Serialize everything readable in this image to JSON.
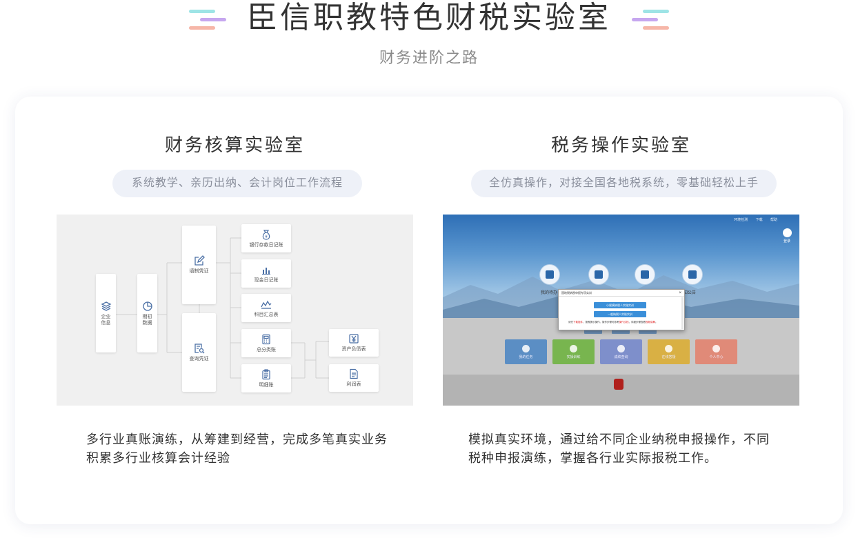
{
  "header": {
    "title": "臣信职教特色财税实验室",
    "subtitle": "财务进阶之路"
  },
  "colors": {
    "deco_teal": "#9ee4e6",
    "deco_purple": "#c6a7ef",
    "deco_peach": "#f6b6a8",
    "pill_bg": "#eef1f8",
    "text_main": "#333333",
    "text_muted": "#8a8f9c"
  },
  "labs": [
    {
      "title": "财务核算实验室",
      "tagline": "系统教学、亲历出纳、会计岗位工作流程",
      "description": "多行业真账演练，从筹建到经营，完成多笔真实业务积累多行业核算会计经验",
      "flow": {
        "nodes": {
          "company_info": "企业信息",
          "opening_data": "期初数据",
          "fill_voucher": "填制凭证",
          "query_voucher": "查询凭证",
          "bank_journal": "银行存款日记账",
          "cash_journal": "现金日记账",
          "account_summary": "科目汇总表",
          "general_ledger": "总分类账",
          "detail_ledger": "明细账",
          "balance_sheet": "资产负债表",
          "income_statement": "利润表"
        },
        "icons": {
          "company_info": "layers-icon",
          "opening_data": "pie-chart-icon",
          "fill_voucher": "edit-icon",
          "query_voucher": "document-search-icon",
          "bank_journal": "money-bag-icon",
          "cash_journal": "chart-icon",
          "account_summary": "line-chart-icon",
          "general_ledger": "calculator-icon",
          "detail_ledger": "clipboard-icon",
          "balance_sheet": "yen-icon",
          "income_statement": "document-icon"
        }
      }
    },
    {
      "title": "税务操作实验室",
      "tagline": "全仿真操作，对接全国各地税系统，零基础轻松上手",
      "description": "模拟真实环境，通过给不同企业纳税申报操作，不同税种申报演练，掌握各行业实际报税工作。",
      "screen": {
        "top_links": [
          "环境检测",
          "下载",
          "帮助"
        ],
        "login_label": "登录",
        "circle_labels": [
          "我的待办",
          "通知公告"
        ],
        "modal": {
          "title": "国地税纳税申报专项实训",
          "close": "×",
          "buttons": [
            "小规模纳税人实账实训",
            "一般纳税人实账实训"
          ],
          "note_prefix": "请先",
          "note_red_1": "下载插件",
          "note_mid": "，按照提示操作。操作步骤可参考",
          "note_red_2": "操作文档",
          "note_end": "，详细步骤查看",
          "note_red_3": "视频讲解",
          "note_tail": "。"
        },
        "tiles": [
          {
            "label": "我的任务",
            "color": "#5b8ec4"
          },
          {
            "label": "实操训练",
            "color": "#78b54f"
          },
          {
            "label": "成绩查询",
            "color": "#7e8fcb"
          },
          {
            "label": "在线答疑",
            "color": "#d9b044"
          },
          {
            "label": "个人中心",
            "color": "#e08a78"
          }
        ]
      }
    }
  ]
}
